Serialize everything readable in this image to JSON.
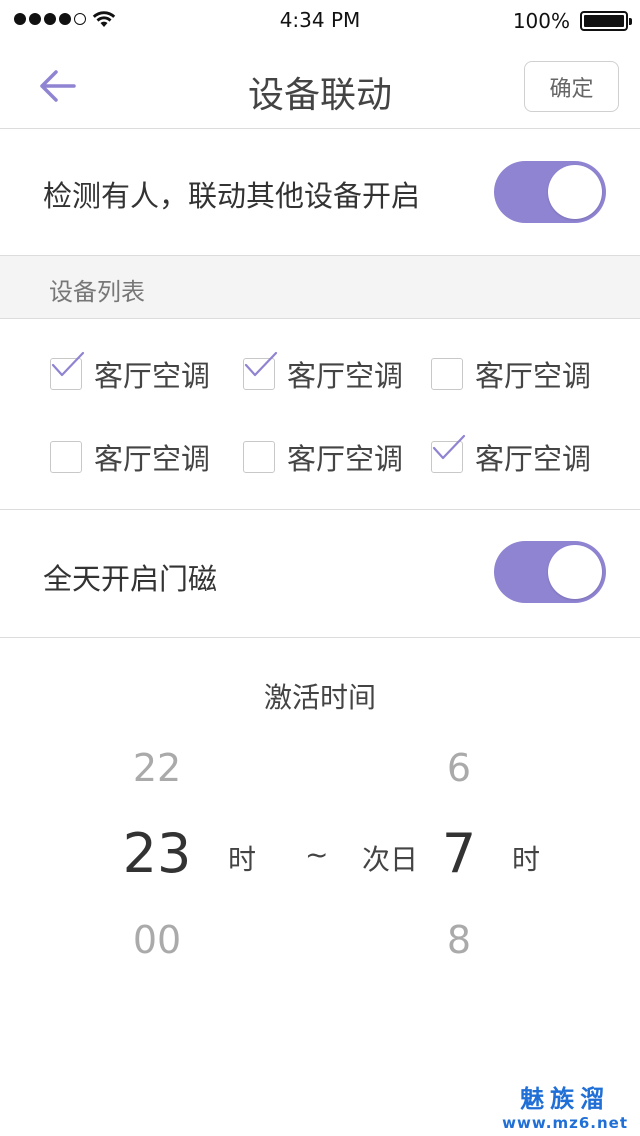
{
  "status_bar": {
    "time": "4:34 PM",
    "battery": "100%",
    "signal_icon": "signal-dots-icon",
    "wifi_icon": "wifi-icon",
    "battery_icon": "battery-icon"
  },
  "nav": {
    "back_icon": "arrow-left-icon",
    "title": "设备联动",
    "confirm_label": "确定"
  },
  "motion_row": {
    "label": "检测有人，联动其他设备开启",
    "toggle_on": true
  },
  "device_section": {
    "header": "设备列表",
    "devices": [
      {
        "label": "客厅空调",
        "checked": true
      },
      {
        "label": "客厅空调",
        "checked": true
      },
      {
        "label": "客厅空调",
        "checked": false
      },
      {
        "label": "客厅空调",
        "checked": false
      },
      {
        "label": "客厅空调",
        "checked": false
      },
      {
        "label": "客厅空调",
        "checked": true
      }
    ]
  },
  "door_row": {
    "label": "全天开启门磁",
    "toggle_on": true
  },
  "activation": {
    "title": "激活时间",
    "start": {
      "above": "22",
      "selected": "23",
      "below": "00",
      "unit": "时"
    },
    "separator": "~",
    "end_prefix": "次日",
    "end": {
      "above": "6",
      "selected": "7",
      "below": "8",
      "unit": "时"
    }
  },
  "watermark": {
    "title": "魅族溜",
    "url": "www.mz6.net"
  },
  "colors": {
    "accent": "#8f84d2",
    "watermark": "#1f6fd6"
  }
}
